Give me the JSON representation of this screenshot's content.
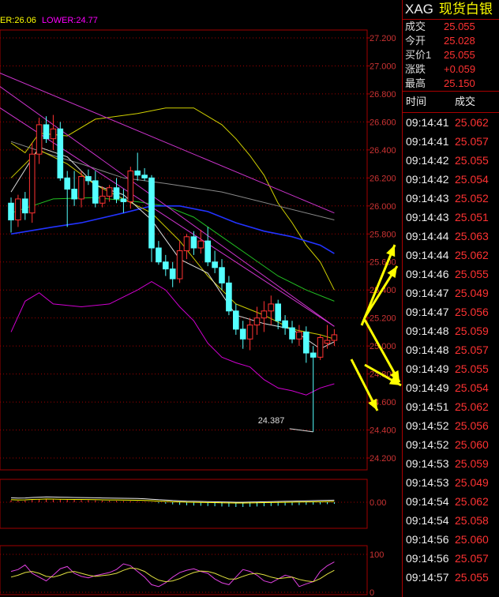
{
  "chart_data": [
    {
      "type": "candlestick",
      "legend": {
        "upper_text": "ER:26.06",
        "lower_text": "LOWER:24.77"
      },
      "y_ticks": [
        "27.200",
        "27.000",
        "26.800",
        "26.600",
        "26.400",
        "26.200",
        "26.000",
        "25.800",
        "25.600",
        "25.400",
        "25.200",
        "25.000",
        "24.800",
        "24.600",
        "24.400",
        "24.200"
      ],
      "ylim": [
        24.2,
        27.2
      ],
      "annotation": "24.387",
      "candles": [
        {
          "o": 26.02,
          "h": 26.06,
          "l": 25.81,
          "c": 25.9
        },
        {
          "o": 25.9,
          "h": 26.08,
          "l": 25.85,
          "c": 26.05
        },
        {
          "o": 26.05,
          "h": 26.1,
          "l": 25.9,
          "c": 25.95
        },
        {
          "o": 25.95,
          "h": 26.45,
          "l": 25.88,
          "c": 26.37
        },
        {
          "o": 26.37,
          "h": 26.63,
          "l": 26.3,
          "c": 26.58
        },
        {
          "o": 26.58,
          "h": 26.64,
          "l": 26.45,
          "c": 26.48
        },
        {
          "o": 26.48,
          "h": 26.65,
          "l": 26.4,
          "c": 26.55
        },
        {
          "o": 26.55,
          "h": 26.6,
          "l": 26.18,
          "c": 26.2
        },
        {
          "o": 26.2,
          "h": 26.25,
          "l": 25.85,
          "c": 26.12
        },
        {
          "o": 26.12,
          "h": 26.25,
          "l": 26.0,
          "c": 26.05
        },
        {
          "o": 26.05,
          "h": 26.25,
          "l": 25.99,
          "c": 26.21
        },
        {
          "o": 26.21,
          "h": 26.26,
          "l": 26.15,
          "c": 26.18
        },
        {
          "o": 26.18,
          "h": 26.25,
          "l": 25.99,
          "c": 26.02
        },
        {
          "o": 26.02,
          "h": 26.14,
          "l": 25.99,
          "c": 26.07
        },
        {
          "o": 26.07,
          "h": 26.15,
          "l": 26.03,
          "c": 26.13
        },
        {
          "o": 26.13,
          "h": 26.2,
          "l": 26.02,
          "c": 26.05
        },
        {
          "o": 26.05,
          "h": 26.12,
          "l": 25.95,
          "c": 26.03
        },
        {
          "o": 26.03,
          "h": 26.28,
          "l": 25.98,
          "c": 26.25
        },
        {
          "o": 26.25,
          "h": 26.38,
          "l": 26.18,
          "c": 26.22
        },
        {
          "o": 26.22,
          "h": 26.27,
          "l": 26.18,
          "c": 26.2
        },
        {
          "o": 26.2,
          "h": 26.22,
          "l": 25.6,
          "c": 25.7
        },
        {
          "o": 25.7,
          "h": 25.75,
          "l": 25.58,
          "c": 25.6
        },
        {
          "o": 25.6,
          "h": 25.65,
          "l": 25.5,
          "c": 25.55
        },
        {
          "o": 25.55,
          "h": 25.6,
          "l": 25.42,
          "c": 25.48
        },
        {
          "o": 25.48,
          "h": 25.75,
          "l": 25.45,
          "c": 25.68
        },
        {
          "o": 25.68,
          "h": 25.8,
          "l": 25.62,
          "c": 25.78
        },
        {
          "o": 25.78,
          "h": 25.82,
          "l": 25.65,
          "c": 25.7
        },
        {
          "o": 25.7,
          "h": 25.83,
          "l": 25.66,
          "c": 25.75
        },
        {
          "o": 25.75,
          "h": 25.85,
          "l": 25.57,
          "c": 25.6
        },
        {
          "o": 25.6,
          "h": 25.68,
          "l": 25.52,
          "c": 25.56
        },
        {
          "o": 25.56,
          "h": 25.62,
          "l": 25.4,
          "c": 25.45
        },
        {
          "o": 25.45,
          "h": 25.5,
          "l": 25.22,
          "c": 25.25
        },
        {
          "o": 25.25,
          "h": 25.3,
          "l": 25.08,
          "c": 25.12
        },
        {
          "o": 25.12,
          "h": 25.18,
          "l": 24.98,
          "c": 25.05
        },
        {
          "o": 25.05,
          "h": 25.2,
          "l": 24.97,
          "c": 25.15
        },
        {
          "o": 25.15,
          "h": 25.28,
          "l": 25.08,
          "c": 25.2
        },
        {
          "o": 25.2,
          "h": 25.32,
          "l": 25.1,
          "c": 25.25
        },
        {
          "o": 25.25,
          "h": 25.36,
          "l": 25.15,
          "c": 25.3
        },
        {
          "o": 25.3,
          "h": 25.33,
          "l": 25.12,
          "c": 25.18
        },
        {
          "o": 25.18,
          "h": 25.22,
          "l": 25.08,
          "c": 25.13
        },
        {
          "o": 25.13,
          "h": 25.18,
          "l": 25.02,
          "c": 25.05
        },
        {
          "o": 25.05,
          "h": 25.15,
          "l": 25.0,
          "c": 25.1
        },
        {
          "o": 25.1,
          "h": 25.14,
          "l": 24.88,
          "c": 24.95
        },
        {
          "o": 24.95,
          "h": 25.0,
          "l": 24.387,
          "c": 24.92
        },
        {
          "o": 24.92,
          "h": 25.08,
          "l": 24.9,
          "c": 25.06
        },
        {
          "o": 25.02,
          "h": 25.15,
          "l": 24.98,
          "c": 25.04
        },
        {
          "o": 25.04,
          "h": 25.12,
          "l": 25.0,
          "c": 25.08
        }
      ],
      "lines": {
        "boll_upper": [
          [
            0,
            26.45
          ],
          [
            2,
            26.38
          ],
          [
            4,
            26.52
          ],
          [
            8,
            26.5
          ],
          [
            12,
            26.62
          ],
          [
            18,
            26.66
          ],
          [
            22,
            26.7
          ],
          [
            26,
            26.7
          ],
          [
            30,
            26.58
          ],
          [
            32,
            26.48
          ],
          [
            34,
            26.36
          ],
          [
            36,
            26.22
          ],
          [
            38,
            26.02
          ],
          [
            40,
            25.88
          ],
          [
            42,
            25.72
          ],
          [
            44,
            25.6
          ],
          [
            46,
            25.4
          ]
        ],
        "boll_lower": [
          [
            0,
            25.1
          ],
          [
            2,
            25.32
          ],
          [
            4,
            25.38
          ],
          [
            6,
            25.3
          ],
          [
            10,
            25.28
          ],
          [
            14,
            25.3
          ],
          [
            18,
            25.4
          ],
          [
            20,
            25.46
          ],
          [
            22,
            25.4
          ],
          [
            24,
            25.28
          ],
          [
            26,
            25.18
          ],
          [
            28,
            25.02
          ],
          [
            30,
            24.92
          ],
          [
            32,
            24.88
          ],
          [
            34,
            24.85
          ],
          [
            36,
            24.76
          ],
          [
            38,
            24.7
          ],
          [
            40,
            24.68
          ],
          [
            42,
            24.65
          ],
          [
            44,
            24.7
          ],
          [
            46,
            24.73
          ]
        ],
        "ma_gray": [
          [
            0,
            26.46
          ],
          [
            6,
            26.36
          ],
          [
            10,
            26.3
          ],
          [
            16,
            26.2
          ],
          [
            22,
            26.16
          ],
          [
            30,
            26.1
          ],
          [
            38,
            26.0
          ],
          [
            46,
            25.9
          ]
        ],
        "ma_green": [
          [
            0,
            25.95
          ],
          [
            6,
            26.05
          ],
          [
            12,
            26.06
          ],
          [
            18,
            26.03
          ],
          [
            22,
            26.0
          ],
          [
            26,
            25.92
          ],
          [
            30,
            25.78
          ],
          [
            34,
            25.64
          ],
          [
            38,
            25.5
          ],
          [
            42,
            25.4
          ],
          [
            46,
            25.32
          ]
        ],
        "ma_blue": [
          [
            0,
            25.8
          ],
          [
            6,
            25.85
          ],
          [
            10,
            25.88
          ],
          [
            16,
            25.95
          ],
          [
            20,
            26.0
          ],
          [
            24,
            26.0
          ],
          [
            28,
            25.96
          ],
          [
            32,
            25.88
          ],
          [
            36,
            25.82
          ],
          [
            40,
            25.78
          ],
          [
            44,
            25.72
          ],
          [
            46,
            25.66
          ]
        ],
        "ma_yellow": [
          [
            0,
            26.2
          ],
          [
            4,
            26.4
          ],
          [
            8,
            26.3
          ],
          [
            12,
            26.15
          ],
          [
            16,
            26.05
          ],
          [
            20,
            25.95
          ],
          [
            24,
            25.75
          ],
          [
            28,
            25.5
          ],
          [
            32,
            25.3
          ],
          [
            36,
            25.22
          ],
          [
            40,
            25.12
          ],
          [
            44,
            25.08
          ],
          [
            46,
            25.05
          ]
        ],
        "ma_white": [
          [
            0,
            26.1
          ],
          [
            4,
            26.42
          ],
          [
            8,
            26.35
          ],
          [
            12,
            26.15
          ],
          [
            16,
            26.08
          ],
          [
            20,
            25.9
          ],
          [
            24,
            25.62
          ],
          [
            28,
            25.52
          ],
          [
            32,
            25.22
          ],
          [
            36,
            25.16
          ],
          [
            40,
            25.12
          ],
          [
            44,
            24.98
          ],
          [
            46,
            25.03
          ]
        ],
        "trend1": [
          [
            -4,
            27.0
          ],
          [
            46,
            25.95
          ]
        ],
        "trend2": [
          [
            -4,
            26.94
          ],
          [
            46,
            25.14
          ]
        ],
        "trend3": [
          [
            -4,
            26.78
          ],
          [
            46,
            25.14
          ]
        ]
      }
    },
    {
      "type": "bar",
      "y_ticks": [
        "0.00"
      ],
      "macd": [
        0.4,
        0.3,
        0.35,
        0.5,
        0.6,
        0.7,
        0.65,
        0.6,
        0.55,
        0.5,
        0.48,
        0.45,
        0.4,
        0.35,
        0.3,
        0.28,
        0.25,
        0.22,
        0.18,
        0.1,
        -0.05,
        -0.2,
        -0.3,
        -0.45,
        -0.55,
        -0.65,
        -0.7,
        -0.75,
        -0.8,
        -0.85,
        -0.9,
        -0.95,
        -1.0,
        -1.0,
        -0.95,
        -0.9,
        -0.85,
        -0.8,
        -0.75,
        -0.7,
        -0.65,
        -0.6,
        -0.55,
        -0.5,
        -0.45,
        -0.4,
        -0.35
      ]
    },
    {
      "type": "line",
      "y_ticks": [
        "100",
        "0"
      ],
      "k": [
        55,
        60,
        72,
        50,
        40,
        30,
        45,
        62,
        68,
        50,
        42,
        38,
        44,
        48,
        52,
        60,
        75,
        70,
        55,
        40,
        20,
        15,
        25,
        40,
        52,
        58,
        62,
        55,
        50,
        35,
        25,
        20,
        40,
        60,
        55,
        45,
        30,
        25,
        35,
        45,
        40,
        15,
        22,
        28,
        55,
        70,
        80
      ],
      "d": [
        40,
        45,
        52,
        55,
        50,
        42,
        40,
        45,
        52,
        55,
        50,
        45,
        42,
        44,
        46,
        50,
        58,
        64,
        62,
        55,
        42,
        32,
        28,
        30,
        36,
        45,
        52,
        56,
        55,
        50,
        42,
        35,
        35,
        42,
        48,
        50,
        46,
        40,
        36,
        38,
        40,
        34,
        30,
        28,
        36,
        48,
        58
      ]
    }
  ],
  "quote": {
    "code": "XAG",
    "name": "现货白银",
    "rows": [
      {
        "label": "成交",
        "value": "25.055"
      },
      {
        "label": "今开",
        "value": "25.028"
      },
      {
        "label": "买价1",
        "value": "25.055"
      },
      {
        "label": "涨跌",
        "value": "+0.059"
      },
      {
        "label": "最高",
        "value": "25.150"
      }
    ]
  },
  "ticks_header": {
    "time": "时间",
    "price": "成交"
  },
  "ticks": [
    {
      "time": "09:14:41",
      "price": "25.062"
    },
    {
      "time": "09:14:41",
      "price": "25.057"
    },
    {
      "time": "09:14:42",
      "price": "25.055"
    },
    {
      "time": "09:14:42",
      "price": "25.054"
    },
    {
      "time": "09:14:43",
      "price": "25.052"
    },
    {
      "time": "09:14:43",
      "price": "25.051"
    },
    {
      "time": "09:14:44",
      "price": "25.063"
    },
    {
      "time": "09:14:44",
      "price": "25.062"
    },
    {
      "time": "09:14:46",
      "price": "25.055"
    },
    {
      "time": "09:14:47",
      "price": "25.049"
    },
    {
      "time": "09:14:47",
      "price": "25.056"
    },
    {
      "time": "09:14:48",
      "price": "25.059"
    },
    {
      "time": "09:14:48",
      "price": "25.057"
    },
    {
      "time": "09:14:49",
      "price": "25.055"
    },
    {
      "time": "09:14:49",
      "price": "25.054"
    },
    {
      "time": "09:14:51",
      "price": "25.062"
    },
    {
      "time": "09:14:52",
      "price": "25.056"
    },
    {
      "time": "09:14:52",
      "price": "25.060"
    },
    {
      "time": "09:14:53",
      "price": "25.059"
    },
    {
      "time": "09:14:53",
      "price": "25.049"
    },
    {
      "time": "09:14:54",
      "price": "25.062"
    },
    {
      "time": "09:14:54",
      "price": "25.058"
    },
    {
      "time": "09:14:56",
      "price": "25.060"
    },
    {
      "time": "09:14:56",
      "price": "25.057"
    },
    {
      "time": "09:14:57",
      "price": "25.055"
    }
  ],
  "colors": {
    "up": "#ff3232",
    "down": "#54ffff",
    "grid": "#a00000",
    "arrow": "#ffff00"
  }
}
